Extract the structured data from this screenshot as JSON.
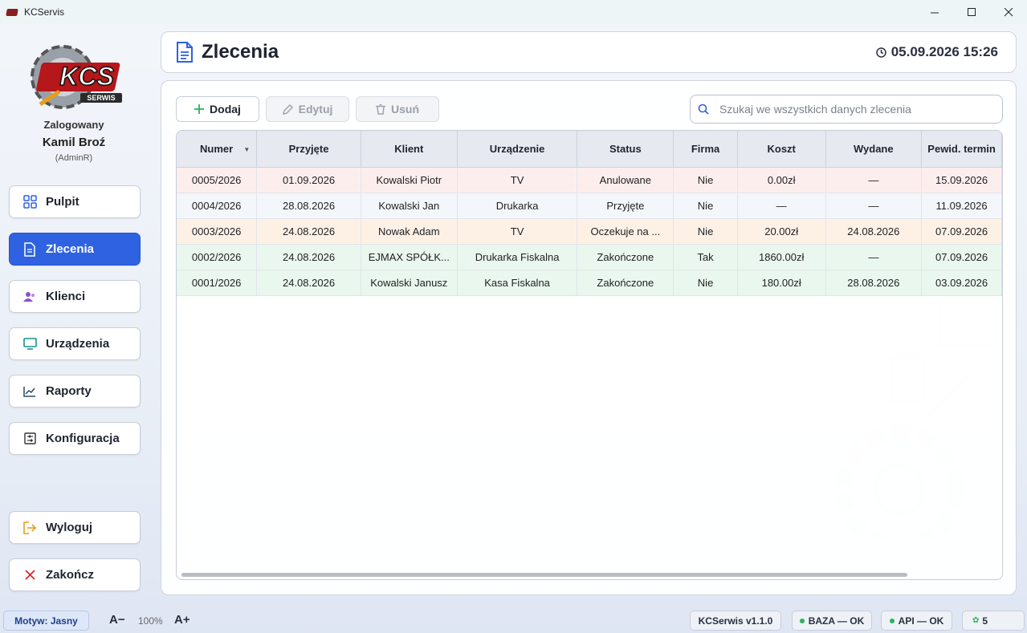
{
  "window": {
    "title": "KCServis"
  },
  "user": {
    "label": "Zalogowany",
    "name": "Kamil Broź",
    "role": "(AdminR)"
  },
  "logo": {
    "text": "KCS",
    "subtext": "SERWIS"
  },
  "nav": {
    "pulpit": "Pulpit",
    "zlecenia": "Zlecenia",
    "klienci": "Klienci",
    "urzadzenia": "Urządzenia",
    "raporty": "Raporty",
    "konfiguracja": "Konfiguracja",
    "wyloguj": "Wyloguj",
    "zakoncz": "Zakończ"
  },
  "header": {
    "title": "Zlecenia",
    "datetime": "05.09.2026 15:26"
  },
  "toolbar": {
    "add": "Dodaj",
    "edit": "Edytuj",
    "delete": "Usuń"
  },
  "search": {
    "placeholder": "Szukaj we wszystkich danych zlecenia"
  },
  "table": {
    "columns": [
      "Numer",
      "Przyjęte",
      "Klient",
      "Urządzenie",
      "Status",
      "Firma",
      "Koszt",
      "Wydane",
      "Pewid. termin"
    ],
    "rows": [
      [
        "0005/2026",
        "01.09.2026",
        "Kowalski Piotr",
        "TV",
        "Anulowane",
        "Nie",
        "0.00zł",
        "—",
        "15.09.2026"
      ],
      [
        "0004/2026",
        "28.08.2026",
        "Kowalski Jan",
        "Drukarka",
        "Przyjęte",
        "Nie",
        "—",
        "—",
        "11.09.2026"
      ],
      [
        "0003/2026",
        "24.08.2026",
        "Nowak Adam",
        "TV",
        "Oczekuje na ...",
        "Nie",
        "20.00zł",
        "24.08.2026",
        "07.09.2026"
      ],
      [
        "0002/2026",
        "24.08.2026",
        "EJMAX SPÓŁK...",
        "Drukarka Fiskalna",
        "Zakończone",
        "Tak",
        "1860.00zł",
        "—",
        "07.09.2026"
      ],
      [
        "0001/2026",
        "24.08.2026",
        "Kowalski Janusz",
        "Kasa Fiskalna",
        "Zakończone",
        "Nie",
        "180.00zł",
        "28.08.2026",
        "03.09.2026"
      ]
    ]
  },
  "status": {
    "theme": "Motyw: Jasny",
    "font_minus": "A−",
    "zoom": "100%",
    "font_plus": "A+",
    "version": "KCSerwis v1.1.0",
    "db": "BAZA — OK",
    "api": "API — OK",
    "count": "5"
  },
  "colors": {
    "accent": "#2f62e0",
    "ok": "#2eb05a"
  }
}
